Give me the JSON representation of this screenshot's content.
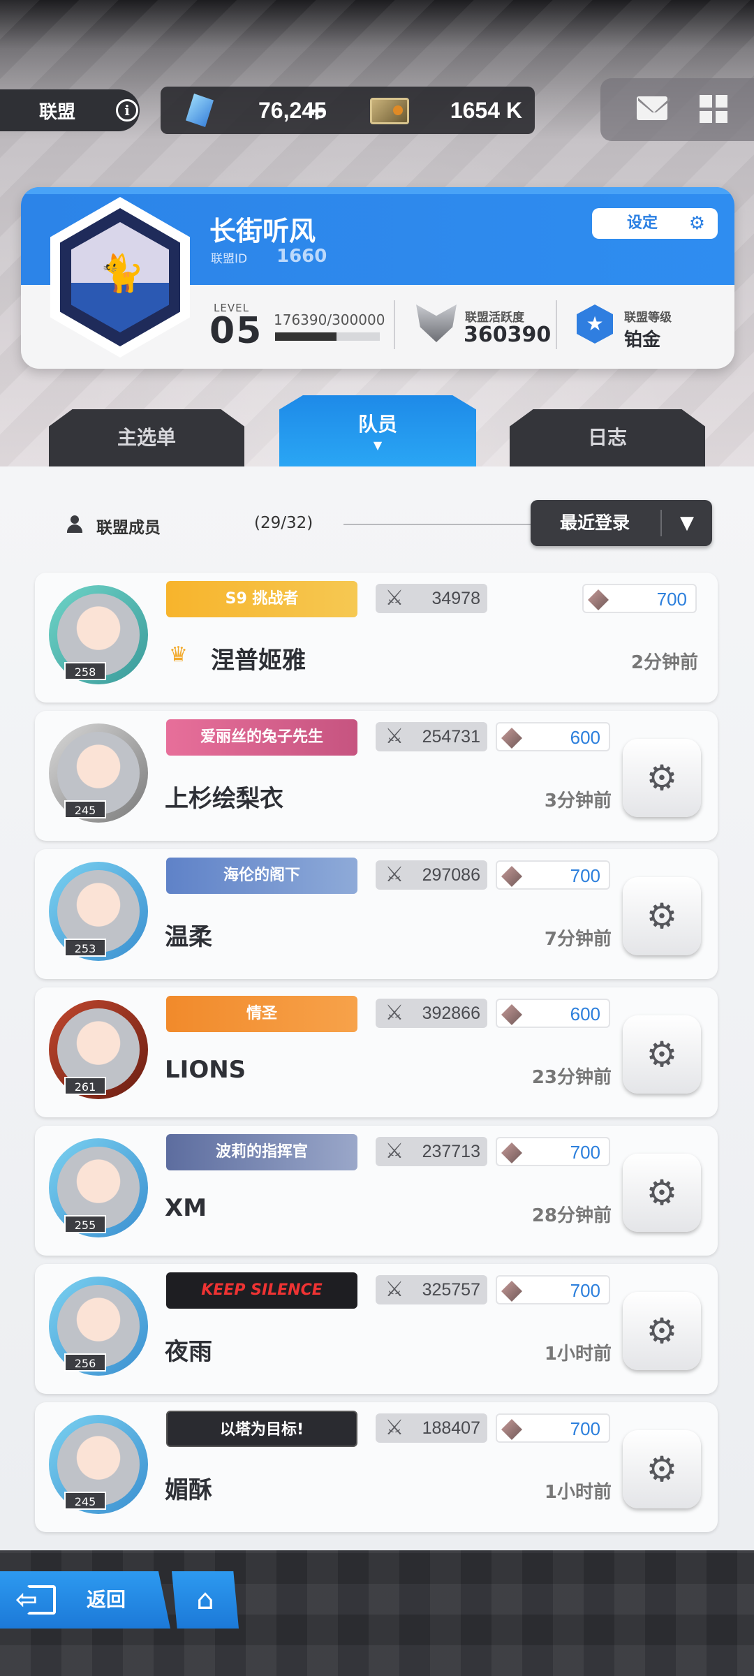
{
  "header": {
    "union_label": "联盟",
    "gems": "76,245",
    "gems_plus": "+",
    "credits": "1654 K",
    "icons": [
      "info-icon",
      "gem-icon",
      "ticket-icon",
      "mail-icon",
      "grid-menu-icon"
    ]
  },
  "union": {
    "name": "长街听风",
    "id_label": "联盟ID",
    "id": "1660",
    "settings_label": "设定",
    "level_label": "LEVEL",
    "level": "05",
    "exp_text": "176390/300000",
    "exp_progress": 0.588,
    "activity_label": "联盟活跃度",
    "activity_value": "360390",
    "rank_label": "联盟等级",
    "rank_value": "铂金"
  },
  "tabs": [
    {
      "label": "主选单"
    },
    {
      "label": "队员",
      "active": true
    },
    {
      "label": "日志"
    }
  ],
  "members_header": {
    "label": "联盟成员",
    "count": "(29/32)",
    "sort_label": "最近登录"
  },
  "members": [
    {
      "name": "涅普姬雅",
      "level": "258",
      "banner": "S9 挑战者",
      "power": "34978",
      "contribution": "700",
      "last_login": "2分钟前",
      "leader": true
    },
    {
      "name": "上杉绘梨衣",
      "level": "245",
      "banner": "爱丽丝的兔子先生",
      "power": "254731",
      "contribution": "600",
      "last_login": "3分钟前"
    },
    {
      "name": "温柔",
      "level": "253",
      "banner": "海伦的阁下",
      "power": "297086",
      "contribution": "700",
      "last_login": "7分钟前"
    },
    {
      "name": "LIONS",
      "level": "261",
      "banner": "情圣",
      "power": "392866",
      "contribution": "600",
      "last_login": "23分钟前"
    },
    {
      "name": "XM",
      "level": "255",
      "banner": "波莉的指挥官",
      "power": "237713",
      "contribution": "700",
      "last_login": "28分钟前"
    },
    {
      "name": "夜雨",
      "level": "256",
      "banner": "KEEP SILENCE",
      "power": "325757",
      "contribution": "700",
      "last_login": "1小时前"
    },
    {
      "name": "媚酥",
      "level": "245",
      "banner": "以塔为目标!",
      "power": "188407",
      "contribution": "700",
      "last_login": "1小时前"
    }
  ],
  "footer": {
    "back_label": "返回"
  },
  "colors": {
    "accent_blue": "#2c84e8",
    "dark_panel": "#34353a",
    "contribution_blue": "#2c7fdc"
  }
}
